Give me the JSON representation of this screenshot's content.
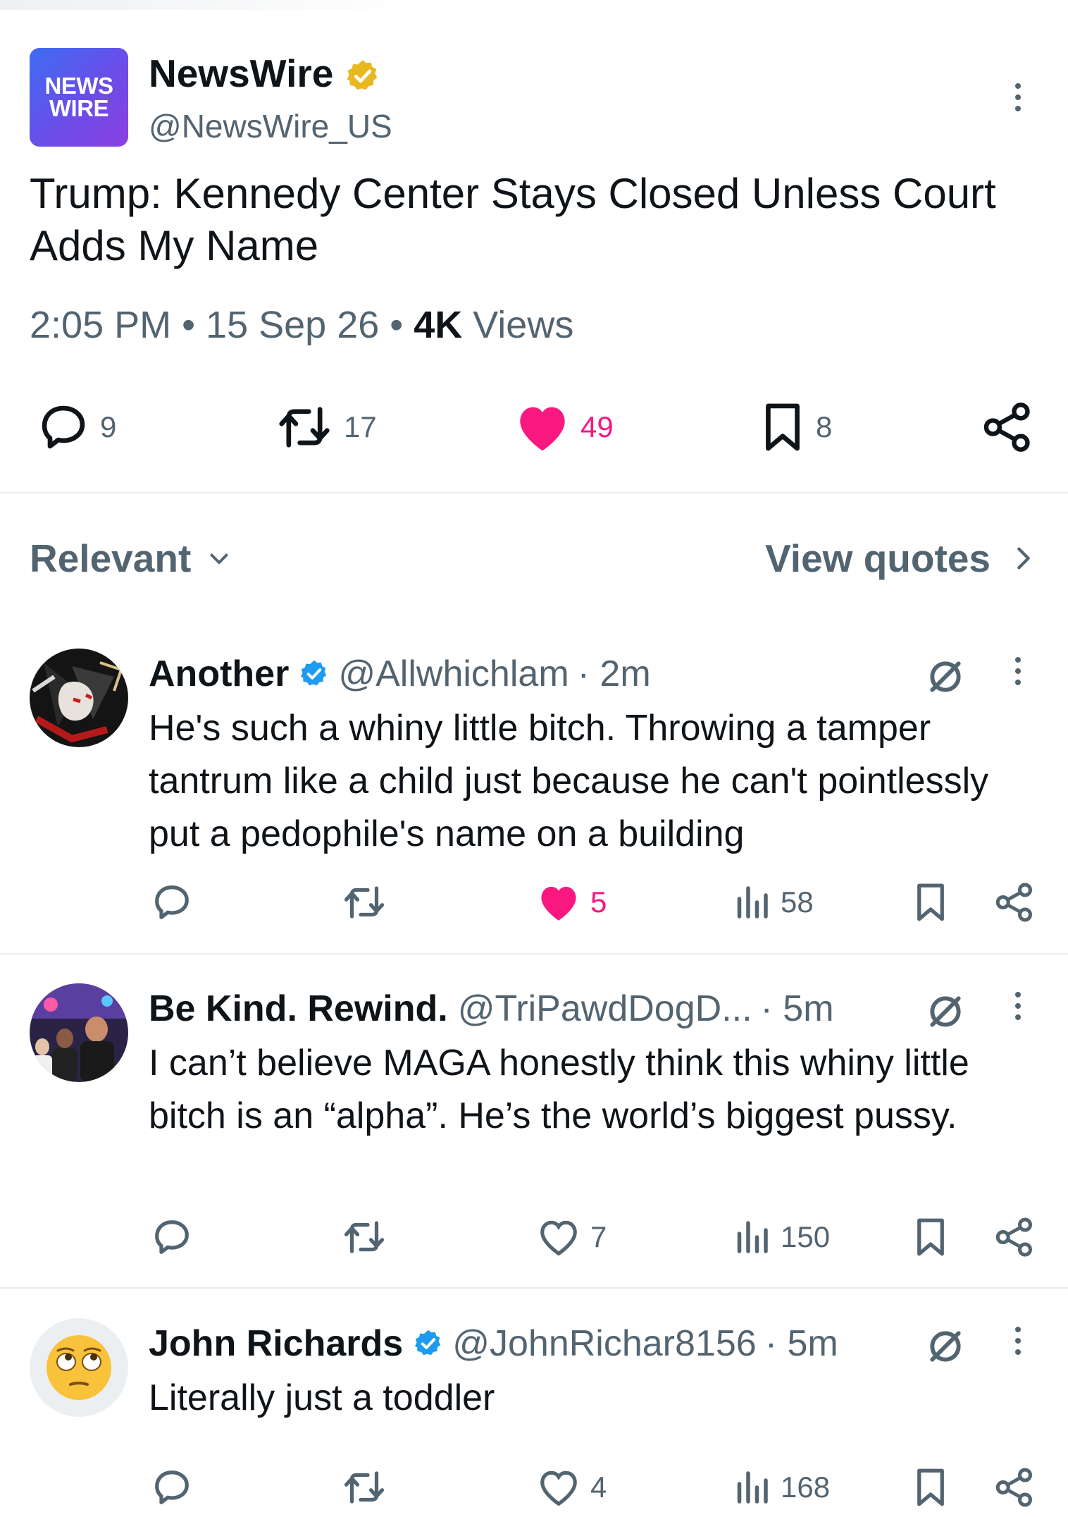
{
  "post": {
    "logo_line1": "NEWS",
    "logo_line2": "WIRE",
    "name": "NewsWire",
    "handle": "@NewsWire_US",
    "headline": "Trump: Kennedy Center Stays Closed Unless Court Adds My Name",
    "time": "2:05 PM",
    "sep": "•",
    "date": "15 Sep 26",
    "views_count": "4K",
    "views_label": "Views",
    "replies": "9",
    "reposts": "17",
    "likes": "49",
    "bookmarks": "8",
    "verified_color": "#e8b820"
  },
  "sort": {
    "label": "Relevant",
    "view_quotes": "View quotes"
  },
  "replies": [
    {
      "name": "Another",
      "handle": "@Allwhichlam",
      "time": "· 2m",
      "text": "He's such a whiny little bitch. Throwing a tamper tantrum like a child just because he can't pointlessly put a pedophile's name on a building",
      "likes": "5",
      "views": "58",
      "liked": true
    },
    {
      "name": "Be Kind. Rewind.",
      "handle": "@TriPawdDogD...",
      "time": "· 5m",
      "text": "I can’t believe MAGA honestly think this whiny little bitch is an “alpha”. He’s the world’s biggest pussy.",
      "likes": "7",
      "views": "150",
      "liked": false
    },
    {
      "name": "John Richards",
      "handle": "@JohnRichar8156",
      "time": "· 5m",
      "text": "Literally just a toddler",
      "likes": "4",
      "views": "168",
      "liked": false
    }
  ],
  "colors": {
    "like": "#f91880",
    "verified_blue": "#1d9bf0",
    "muted": "#536471"
  }
}
